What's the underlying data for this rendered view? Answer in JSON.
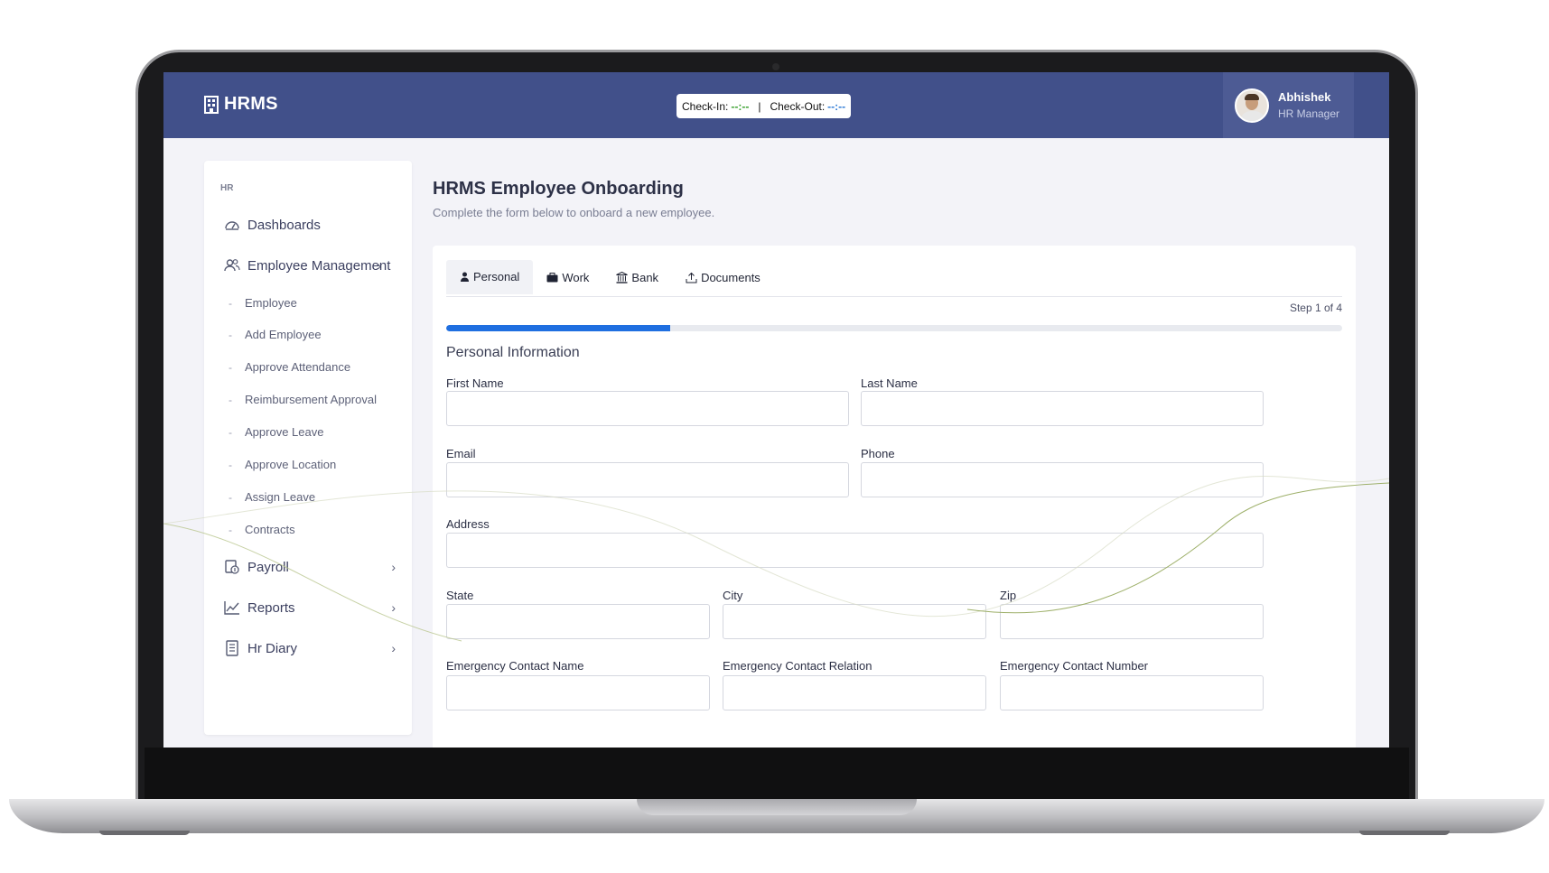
{
  "app": {
    "brand": "HRMS",
    "checkin_label": "Check-In:",
    "checkin_value": "--:--",
    "checkout_label": "Check-Out:",
    "checkout_value": "--:--",
    "separator": "|"
  },
  "user": {
    "name": "Abhishek",
    "role": "HR Manager"
  },
  "sidebar": {
    "section": "HR",
    "items": [
      {
        "label": "Dashboards",
        "icon": "dashboard-gauge-icon"
      },
      {
        "label": "Employee Management",
        "icon": "users-icon"
      },
      {
        "label": "Payroll",
        "icon": "payroll-icon"
      },
      {
        "label": "Reports",
        "icon": "chart-line-icon"
      },
      {
        "label": "Hr Diary",
        "icon": "diary-icon"
      }
    ],
    "sub_items": [
      "Employee",
      "Add Employee",
      "Approve Attendance",
      "Reimbursement Approval",
      "Approve Leave",
      "Approve Location",
      "Assign Leave",
      "Contracts"
    ],
    "dash": "-",
    "chevron": "›"
  },
  "page": {
    "title": "HRMS Employee Onboarding",
    "subtitle": "Complete the form below to onboard a new employee."
  },
  "tabs": [
    {
      "label": "Personal",
      "icon": "user-icon",
      "active": true
    },
    {
      "label": "Work",
      "icon": "briefcase-icon",
      "active": false
    },
    {
      "label": "Bank",
      "icon": "bank-icon",
      "active": false
    },
    {
      "label": "Documents",
      "icon": "upload-icon",
      "active": false
    }
  ],
  "progress": {
    "step_text": "Step 1 of 4",
    "fraction": 0.25
  },
  "form": {
    "section_title": "Personal Information",
    "fields": {
      "first_name": {
        "label": "First Name",
        "value": ""
      },
      "last_name": {
        "label": "Last Name",
        "value": ""
      },
      "email": {
        "label": "Email",
        "value": ""
      },
      "phone": {
        "label": "Phone",
        "value": ""
      },
      "address": {
        "label": "Address",
        "value": ""
      },
      "state": {
        "label": "State",
        "value": ""
      },
      "city": {
        "label": "City",
        "value": ""
      },
      "zip": {
        "label": "Zip",
        "value": ""
      },
      "ec_name": {
        "label": "Emergency Contact Name",
        "value": ""
      },
      "ec_relation": {
        "label": "Emergency Contact Relation",
        "value": ""
      },
      "ec_number": {
        "label": "Emergency Contact Number",
        "value": ""
      }
    }
  },
  "colors": {
    "header": "#41508a",
    "accent": "#1f6fe0",
    "checkin": "#3aa12f",
    "checkout": "#2e7bd6",
    "background": "#f3f3f8"
  }
}
